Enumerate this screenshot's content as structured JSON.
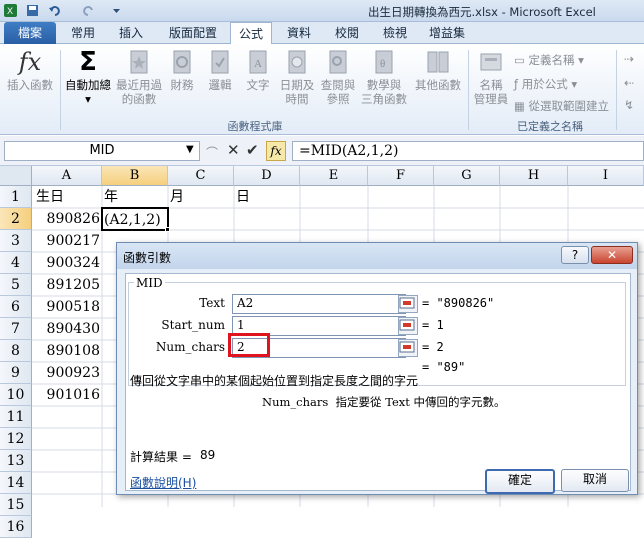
{
  "window": {
    "title": "出生日期轉換為西元.xlsx - Microsoft Excel"
  },
  "ribbon": {
    "tabs": [
      "檔案",
      "常用",
      "插入",
      "版面配置",
      "公式",
      "資料",
      "校閱",
      "檢視",
      "增益集"
    ],
    "buttons": {
      "insert_function": "插入函數",
      "autosum": "自動加總",
      "recent": [
        "最近用過",
        "的函數"
      ],
      "financial": "財務",
      "logical": "邏輯",
      "text": "文字",
      "datetime": [
        "日期及",
        "時間"
      ],
      "lookup": [
        "查閱與",
        "參照"
      ],
      "math": [
        "數學與",
        "三角函數"
      ],
      "more": "其他函數",
      "name_manager": [
        "名稱",
        "管理員"
      ],
      "define_name": "定義名稱",
      "use_in_formula": "用於公式",
      "create_from_selection": "從選取範圍建立"
    },
    "groups": {
      "function_library": "函數程式庫",
      "defined_names": "已定義之名稱"
    }
  },
  "formula_bar": {
    "name_box": "MID",
    "fx": "fx",
    "formula": "=MID(A2,1,2)"
  },
  "sheet": {
    "columns": [
      "A",
      "B",
      "C",
      "D",
      "E",
      "F",
      "G",
      "H",
      "I"
    ],
    "rows": [
      "1",
      "2",
      "3",
      "4",
      "5",
      "6",
      "7",
      "8",
      "9",
      "10",
      "11",
      "12",
      "13",
      "14",
      "15",
      "16"
    ],
    "header_row": {
      "A": "生日",
      "B": "年",
      "C": "月",
      "D": "日"
    },
    "birthdays": [
      "890826",
      "900217",
      "900324",
      "891205",
      "900518",
      "890430",
      "890108",
      "900923",
      "901016"
    ],
    "b2_edit": "(A2,1,2)"
  },
  "dialog": {
    "title": "函數引數",
    "function_name": "MID",
    "args": [
      {
        "label": "Text",
        "value": "A2",
        "result": "= \"890826\""
      },
      {
        "label": "Start_num",
        "value": "1",
        "result": "= 1"
      },
      {
        "label": "Num_chars",
        "value": "2",
        "result": "= 2"
      }
    ],
    "overall_result": "= \"89\"",
    "description": "傳回從文字串中的某個起始位置到指定長度之間的字元",
    "arg_help": "Num_chars  指定要從 Text 中傳回的字元數。",
    "calc_result_label": "計算結果 =",
    "calc_result_value": "89",
    "help_link": "函數說明(H)",
    "ok": "確定",
    "cancel": "取消",
    "help_btn": "?",
    "close_btn": "✕"
  },
  "colors": {
    "highlight_box": "#e0141e",
    "selected_header": "#f9d99a",
    "link": "#1a4fa0"
  }
}
